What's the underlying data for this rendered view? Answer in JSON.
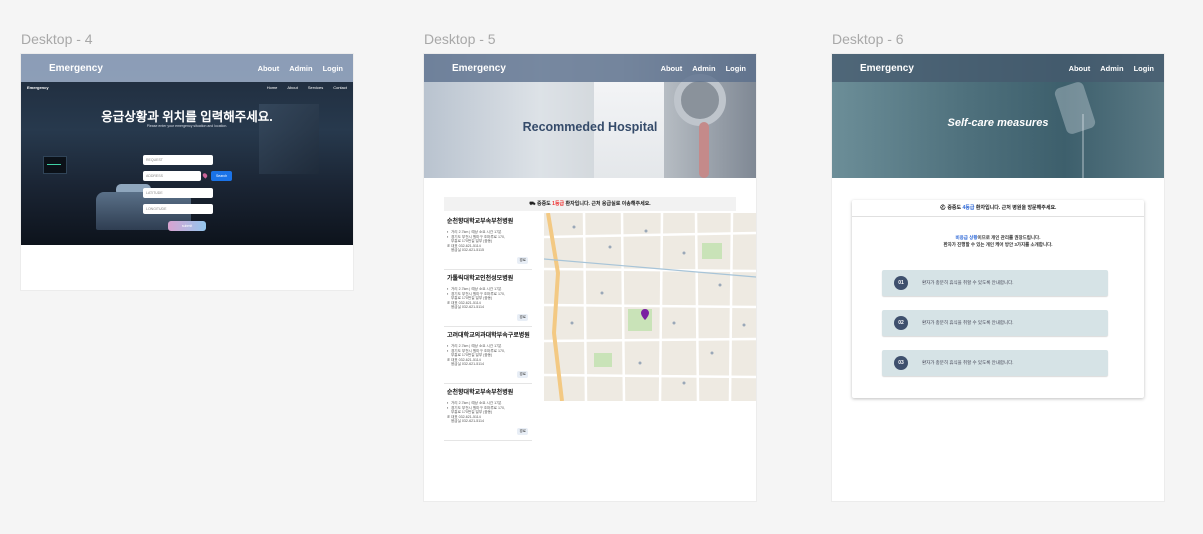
{
  "frames": [
    {
      "label": "Desktop - 4",
      "nav": {
        "brand": "Emergency",
        "links": [
          "About",
          "Admin",
          "Login"
        ]
      },
      "sub_nav": {
        "brand": "Emergency",
        "links": [
          "Home",
          "About",
          "Services",
          "Contact"
        ]
      },
      "hero": {
        "title": "응급상황과 위치를 입력해주세요.",
        "subtitle": "Please enter your emergency situation and location."
      },
      "form": {
        "request_placeholder": "REQUEST",
        "address_placeholder": "ADDRESS",
        "latitude_placeholder": "LATITUDE",
        "longitude_placeholder": "LONGITUDE",
        "search_label": "Search",
        "submit_label": "submit"
      }
    },
    {
      "label": "Desktop - 5",
      "nav": {
        "brand": "Emergency",
        "links": [
          "About",
          "Admin",
          "Login"
        ]
      },
      "hero": {
        "title": "Recommeded Hospital"
      },
      "notice": {
        "prefix": "중증도 ",
        "level": "1등급",
        "suffix": " 환자입니다. 근처 응급실로 이송해주세요."
      },
      "hospitals": [
        {
          "name": "순천향대학교부속부천병원",
          "distance": "거리 2.7km | 예상 소요 시간 17분",
          "addr1": "경기도 부천시 원미구 조마루로 170,",
          "addr2": "부흥로 170번길 일부 (중동)",
          "tel": "대표 032-621-5114",
          "er": "응급실 032-621-5115",
          "btn": "경로"
        },
        {
          "name": "가톨릭대학교인천성모병원",
          "distance": "거리 2.7km | 예상 소요 시간 17분",
          "addr1": "경기도 부천시 원미구 조마루로 170,",
          "addr2": "부흥로 170번길 일부 (중동)",
          "tel": "대표 032-621-5114",
          "er": "응급실 032-621-5114",
          "btn": "경로"
        },
        {
          "name": "고려대학교의과대학부속구로병원",
          "distance": "거리 2.7km | 예상 소요 시간 17분",
          "addr1": "경기도 부천시 원미구 조마루로 170,",
          "addr2": "부흥로 170번길 일부 (중동)",
          "tel": "대표 032-621-5114",
          "er": "응급실 032-621-5114",
          "btn": "경로"
        },
        {
          "name": "순천향대학교부속부천병원",
          "distance": "거리 2.7km | 예상 소요 시간 17분",
          "addr1": "경기도 부천시 원미구 조마루로 170,",
          "addr2": "부흥로 170번길 일부 (중동)",
          "tel": "대표 032-621-5114",
          "er": "응급실 032-621-5114",
          "btn": "경로"
        }
      ]
    },
    {
      "label": "Desktop - 6",
      "nav": {
        "brand": "Emergency",
        "links": [
          "About",
          "Admin",
          "Login"
        ]
      },
      "hero": {
        "title": "Self-care measures"
      },
      "notice": {
        "prefix": "중증도 ",
        "level": "4등급",
        "suffix": " 환자입니다. 근처 병원을 방문해주세요."
      },
      "message": {
        "line1_hl": "비응급 상황",
        "line1_rest": "이므로 개인 관리를 권장드립니다.",
        "line2": "환자가 진행할 수 있는 개인 케어 방안 3가지를 소개합니다."
      },
      "steps": [
        {
          "num": "01",
          "text": "환자가 충분히 휴식을 취할 수 있도록 안내합니다."
        },
        {
          "num": "02",
          "text": "환자가 충분히 휴식을 취할 수 있도록 안내합니다."
        },
        {
          "num": "03",
          "text": "환자가 충분히 휴식을 취할 수 있도록 안내합니다."
        }
      ]
    }
  ],
  "colors": {
    "accent_blue": "#1a73e8",
    "level_red": "#e33333",
    "level_blue": "#2b66d6",
    "step_bg": "#d6e3e6",
    "step_num": "#3e506d"
  }
}
